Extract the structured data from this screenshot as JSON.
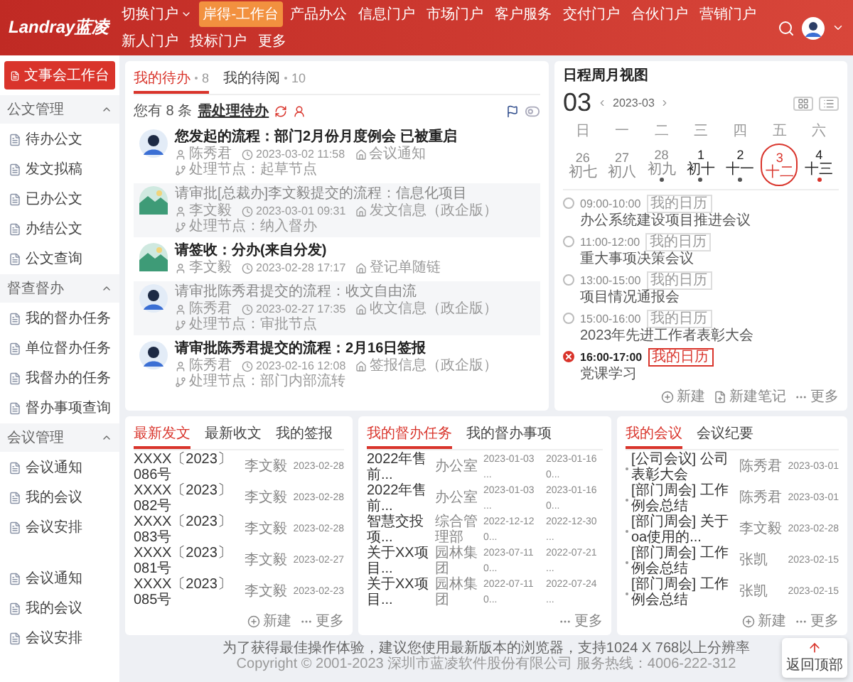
{
  "header": {
    "logo": "Landray蓝凌",
    "nav": [
      {
        "label": "切换门户",
        "has_menu": true,
        "selected": false
      },
      {
        "label": "岸得-工作台",
        "has_menu": false,
        "selected": true
      },
      {
        "label": "产品办公",
        "has_menu": false,
        "selected": false
      },
      {
        "label": "信息门户",
        "has_menu": false,
        "selected": false
      },
      {
        "label": "市场门户",
        "has_menu": false,
        "selected": false
      },
      {
        "label": "客户服务",
        "has_menu": false,
        "selected": false
      },
      {
        "label": "交付门户",
        "has_menu": false,
        "selected": false
      },
      {
        "label": "合伙门户",
        "has_menu": false,
        "selected": false
      },
      {
        "label": "营销门户",
        "has_menu": false,
        "selected": false
      },
      {
        "label": "新人门户",
        "has_menu": false,
        "selected": false
      },
      {
        "label": "投标门户",
        "has_menu": false,
        "selected": false
      },
      {
        "label": "更多",
        "has_menu": false,
        "selected": false
      }
    ]
  },
  "sidebar": {
    "home": {
      "label": "文事会工作台",
      "selected": true
    },
    "groups": [
      {
        "title": "公文管理",
        "expanded": true,
        "items": [
          {
            "label": "待办公文",
            "selected": false
          },
          {
            "label": "发文拟稿",
            "selected": false
          },
          {
            "label": "已办公文",
            "selected": false
          },
          {
            "label": "办结公文",
            "selected": false
          },
          {
            "label": "公文查询",
            "selected": false
          }
        ]
      },
      {
        "title": "督查督办",
        "expanded": true,
        "items": [
          {
            "label": "我的督办任务",
            "selected": false
          },
          {
            "label": "单位督办任务",
            "selected": false
          },
          {
            "label": "我督办的任务",
            "selected": false
          },
          {
            "label": "督办事项查询",
            "selected": false
          }
        ]
      },
      {
        "title": "会议管理",
        "expanded": true,
        "items": [
          {
            "label": "会议通知",
            "selected": false
          },
          {
            "label": "我的会议",
            "selected": false
          },
          {
            "label": "会议安排",
            "selected": false
          }
        ]
      }
    ],
    "extra_items": [
      {
        "label": "会议通知",
        "selected": false
      },
      {
        "label": "我的会议",
        "selected": false
      },
      {
        "label": "会议安排",
        "selected": false
      }
    ]
  },
  "todo": {
    "tabs": [
      {
        "label": "我的待办",
        "count": "8",
        "selected": true
      },
      {
        "label": "我的待阅",
        "count": "10",
        "selected": false
      }
    ],
    "info": {
      "prefix": "您有 8 条",
      "link": "需处理待办"
    },
    "items": [
      {
        "avatar": {
          "kind": "person"
        },
        "read": false,
        "title": "您发起的流程：部门2月份月度例会 已被重启",
        "person": "陈秀君",
        "time": "2023-03-02 11:58",
        "category": "会议通知",
        "node": "处理节点：起草节点"
      },
      {
        "avatar": {
          "kind": "landscape"
        },
        "read": true,
        "title": "请审批[总裁办]李文毅提交的流程：信息化项目",
        "person": "李文毅",
        "time": "2023-03-01 09:31",
        "category": "发文信息（政企版）",
        "node": "处理节点：纳入督办"
      },
      {
        "avatar": {
          "kind": "landscape"
        },
        "read": false,
        "title": "请签收：分办(来自分发)",
        "person": "李文毅",
        "time": "2023-02-28 17:17",
        "category": "登记单随链"
      },
      {
        "avatar": {
          "kind": "person"
        },
        "read": true,
        "title": "请审批陈秀君提交的流程：收文自由流",
        "person": "陈秀君",
        "time": "2023-02-27 17:35",
        "category": "收文信息（政企版）",
        "node": "处理节点：审批节点"
      },
      {
        "avatar": {
          "kind": "person"
        },
        "read": false,
        "title": "请审批陈秀君提交的流程：2月16日签报",
        "person": "陈秀君",
        "time": "2023-02-16 12:08",
        "category": "签报信息（政企版）",
        "node": "处理节点：部门内部流转"
      }
    ]
  },
  "calendar": {
    "title": "日程周月视图",
    "day": "03",
    "month": "2023-03",
    "weekdays": [
      "日",
      "一",
      "二",
      "三",
      "四",
      "五",
      "六"
    ],
    "days": [
      {
        "date": "26",
        "lunar": "初七",
        "muted": true,
        "selected": false
      },
      {
        "date": "27",
        "lunar": "初八",
        "muted": true,
        "selected": false
      },
      {
        "date": "28",
        "lunar": "初九",
        "muted": true,
        "selected": false,
        "color": "#555555"
      },
      {
        "date": "1",
        "lunar": "初十",
        "muted": false,
        "selected": false,
        "color": "#555555"
      },
      {
        "date": "2",
        "lunar": "十一",
        "muted": false,
        "selected": false,
        "color": "#555555"
      },
      {
        "date": "3",
        "lunar": "十二",
        "muted": false,
        "selected": true
      },
      {
        "date": "4",
        "lunar": "十三",
        "muted": false,
        "selected": false,
        "color": "#d9342b"
      }
    ],
    "events": [
      {
        "time": "09:00-10:00",
        "tag": "我的日历",
        "title": "办公系统建设项目推进会议",
        "current": false
      },
      {
        "time": "11:00-12:00",
        "tag": "我的日历",
        "title": "重大事项决策会议",
        "current": false
      },
      {
        "time": "13:00-15:00",
        "tag": "我的日历",
        "title": "项目情况通报会",
        "current": false
      },
      {
        "time": "15:00-16:00",
        "tag": "我的日历",
        "title": "2023年先进工作者表彰大会",
        "current": false
      },
      {
        "time": "16:00-17:00",
        "tag": "我的日历",
        "title": "党课学习",
        "current": true
      }
    ],
    "actions": [
      {
        "kind": "new",
        "label": "新建"
      },
      {
        "kind": "note",
        "label": "新建笔记"
      },
      {
        "kind": "more",
        "label": "更多"
      }
    ]
  },
  "panels": [
    {
      "kind": "documents",
      "tabs": [
        {
          "label": "最新发文",
          "selected": true
        },
        {
          "label": "最新收文",
          "selected": false
        },
        {
          "label": "我的签报",
          "selected": false
        }
      ],
      "rows": [
        [
          "XXXX〔2023〕086号",
          "李文毅",
          "2023-02-28"
        ],
        [
          "XXXX〔2023〕082号",
          "李文毅",
          "2023-02-28"
        ],
        [
          "XXXX〔2023〕083号",
          "李文毅",
          "2023-02-28"
        ],
        [
          "XXXX〔2023〕081号",
          "李文毅",
          "2023-02-27"
        ],
        [
          "XXXX〔2023〕085号",
          "李文毅",
          "2023-02-23"
        ]
      ],
      "actions": [
        {
          "kind": "new",
          "label": "新建"
        },
        {
          "kind": "more",
          "label": "更多"
        }
      ]
    },
    {
      "kind": "tasks",
      "tabs": [
        {
          "label": "我的督办任务",
          "selected": true
        },
        {
          "label": "我的督办事项",
          "selected": false
        }
      ],
      "rows": [
        [
          "2022年售前...",
          "办公室",
          "2023-01-03 ...",
          "2023-01-16 0..."
        ],
        [
          "2022年售前...",
          "办公室",
          "2023-01-03 ...",
          "2023-01-16 0..."
        ],
        [
          "智慧交投项...",
          "综合管理部",
          "2022-12-12 0...",
          "2022-12-30 ..."
        ],
        [
          "关于XX项目...",
          "园林集团",
          "2023-07-11 0...",
          "2022-07-21 ..."
        ],
        [
          "关于XX项目...",
          "园林集团",
          "2022-07-11 0...",
          "2022-07-24 ..."
        ]
      ],
      "actions": [
        {
          "kind": "more",
          "label": "更多"
        }
      ]
    },
    {
      "kind": "meetings",
      "tabs": [
        {
          "label": "我的会议",
          "selected": true
        },
        {
          "label": "会议纪要",
          "selected": false
        }
      ],
      "rows": [
        [
          "[公司会议] 公司表彰大会",
          "陈秀君",
          "2023-03-01"
        ],
        [
          "[部门周会] 工作例会总结",
          "陈秀君",
          "2023-03-01"
        ],
        [
          "[部门周会] 关于oa使用的...",
          "李文毅",
          "2023-02-28"
        ],
        [
          "[部门周会] 工作例会总结",
          "张凯",
          "2023-02-15"
        ],
        [
          "[部门周会] 工作例会总结",
          "张凯",
          "2023-02-15"
        ]
      ],
      "actions": [
        {
          "kind": "new",
          "label": "新建"
        },
        {
          "kind": "more",
          "label": "更多"
        }
      ]
    }
  ],
  "back_to_top": "返回顶部",
  "footer": {
    "notice": "为了获得最佳操作体验，建议您使用最新版本的浏览器，支持1024 X 768以上分辨率",
    "copyright": "Copyright © 2001-2023 深圳市蓝凌软件股份有限公司 服务热线：4006-222-312"
  }
}
